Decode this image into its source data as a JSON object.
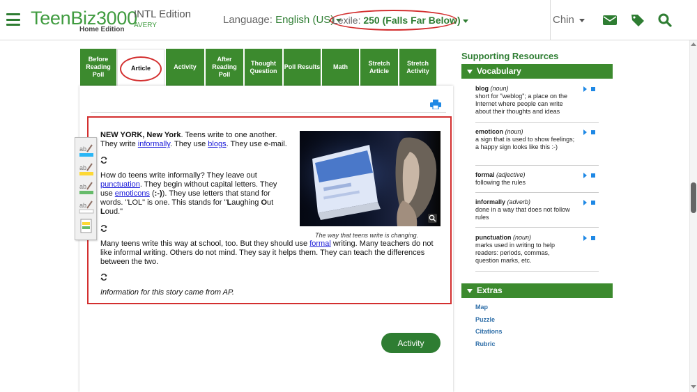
{
  "header": {
    "brand": "TeenBiz3000",
    "brand_sub": "Home Edition",
    "edition": "INTL Edition",
    "school": "AVERY",
    "language_label": "Language:",
    "language_value": "English (US)",
    "lexile_label": "Lexile:",
    "lexile_value": "250 (Falls Far Below)",
    "user": "Chin",
    "icons": [
      "menu-icon",
      "mail-icon",
      "tag-icon",
      "search-icon"
    ]
  },
  "tabs": [
    {
      "label": "Before Reading Poll"
    },
    {
      "label": "Article"
    },
    {
      "label": "Activity"
    },
    {
      "label": "After Reading Poll"
    },
    {
      "label": "Thought Question"
    },
    {
      "label": "Poll Results"
    },
    {
      "label": "Math"
    },
    {
      "label": "Stretch Article"
    },
    {
      "label": "Stretch Activity"
    }
  ],
  "article": {
    "p1_bold": "NEW YORK, New York",
    "p1_a": ". Teens write to one another. They write ",
    "p1_link1": "informally",
    "p1_b": ". They use ",
    "p1_link2": "blogs",
    "p1_c": ". They use e-mail.",
    "p2_a": "How do teens write informally? They leave out ",
    "p2_link1": "punctuation",
    "p2_b": ". They begin without capital letters. They use ",
    "p2_link2": "emoticons",
    "p2_c": " (",
    "p2_emo": ":-)",
    "p2_d": "). They use letters that stand for words. \"LOL\" is one. This stands for \"",
    "p2_L": "L",
    "p2_e": "aughing ",
    "p2_O": "O",
    "p2_f": "ut ",
    "p2_L2": "L",
    "p2_g": "oud.\"",
    "p3_a": "Many teens write this way at school, too. But they should use ",
    "p3_link": "formal",
    "p3_b": " writing. Many teachers do not like informal writing. Others do not mind. They say it helps them. They can teach the differences between the two.",
    "source": "Information for this story came from AP.",
    "caption": "The way that teens write is changing.",
    "activity_button": "Activity"
  },
  "sidebar": {
    "title": "Supporting Resources",
    "vocab_header": "Vocabulary",
    "vocab": [
      {
        "word": "blog",
        "pos": "(noun)",
        "def": "short for \"weblog\"; a place on the Internet where people can write about their thoughts and ideas"
      },
      {
        "word": "emoticon",
        "pos": "(noun)",
        "def": "a sign that is used to show feelings; a happy sign looks like this :-)"
      },
      {
        "word": "formal",
        "pos": "(adjective)",
        "def": "following the rules"
      },
      {
        "word": "informally",
        "pos": "(adverb)",
        "def": "done in a way that does not follow rules"
      },
      {
        "word": "punctuation",
        "pos": "(noun)",
        "def": "marks used in writing to help readers: periods, commas, question marks, etc."
      }
    ],
    "extras_header": "Extras",
    "extras": [
      "Map",
      "Puzzle",
      "Citations",
      "Rubric"
    ]
  },
  "colors": {
    "brand_green": "#3c8a2e",
    "highlight_red": "#d32f2f",
    "link_blue": "#1a1ad9"
  }
}
